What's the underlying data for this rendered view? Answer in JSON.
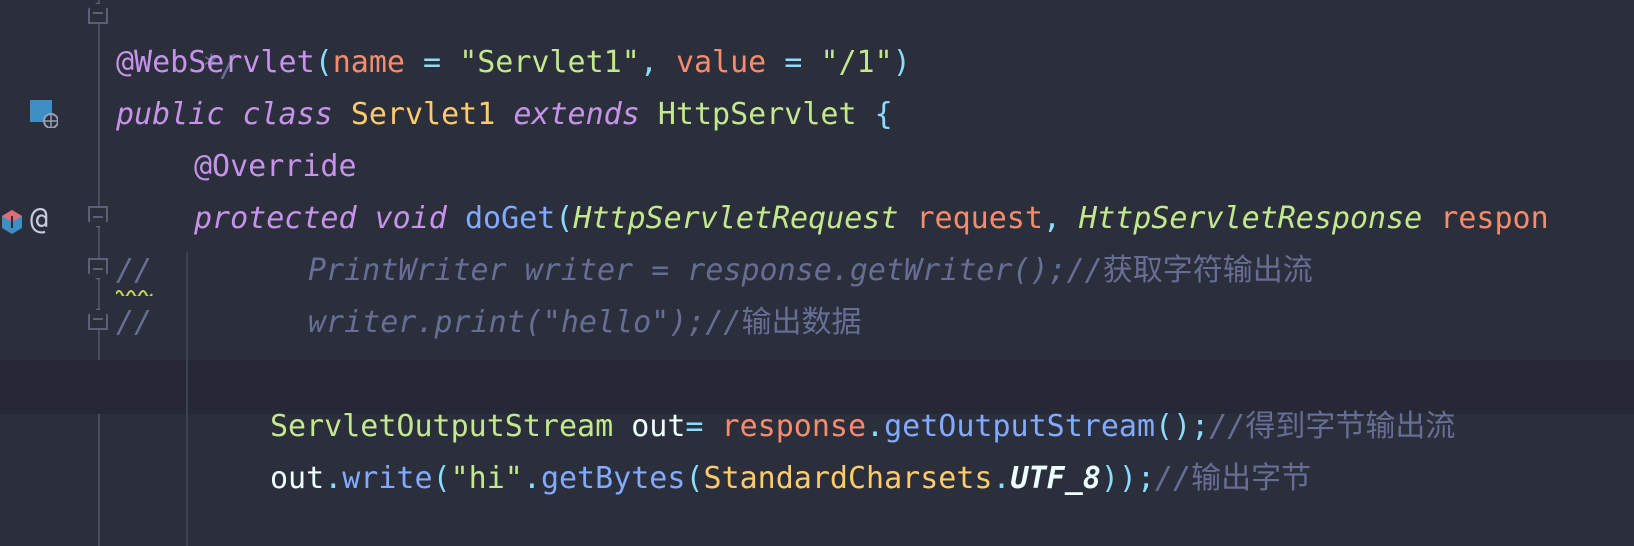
{
  "editor": {
    "lines": {
      "l0": {
        "text": "*/"
      },
      "l1": {
        "annotation": "@WebServlet",
        "open_paren": "(",
        "name_key": "name",
        "eq1": " = ",
        "name_val": "\"Servlet1\"",
        "comma": ", ",
        "value_key": "value",
        "eq2": " = ",
        "value_val": "\"/1\"",
        "close_paren": ")"
      },
      "l2": {
        "kw_public": "public",
        "kw_class": "class",
        "class_name": "Servlet1",
        "kw_extends": "extends",
        "super_name": "HttpServlet",
        "brace": "{"
      },
      "l3": {
        "annotation": "@Override"
      },
      "l4": {
        "kw_protected": "protected",
        "kw_void": "void",
        "method": "doGet",
        "open_paren": "(",
        "type1": "HttpServletRequest",
        "param1": "request",
        "comma": ", ",
        "type2": "HttpServletResponse",
        "param2": "respon"
      },
      "l5": {
        "slashes": "//",
        "code": "PrintWriter writer = response.getWriter();//",
        "cn": "获取字符输出流"
      },
      "l6": {
        "slashes": "//",
        "code": "writer.print(\"hello\");//",
        "cn": "输出数据"
      },
      "l8": {
        "type": "ServletOutputStream",
        "var": "out",
        "eq": "= ",
        "obj": "response",
        "dot": ".",
        "method": "getOutputStream",
        "call": "();",
        "comment": "//",
        "cn": "得到字节输出流"
      },
      "l9": {
        "obj": "out",
        "dot1": ".",
        "method1": "write",
        "open1": "(",
        "str": "\"hi\"",
        "dot2": ".",
        "method2": "getBytes",
        "open2": "(",
        "cls": "StandardCharsets",
        "dot3": ".",
        "const": "UTF_8",
        "close": "));",
        "comment": "//",
        "cn": "输出字节"
      }
    },
    "gutter": {
      "at_icon": "@",
      "icons": [
        "servlet-icon",
        "implements-icon",
        "fold-icon"
      ]
    },
    "colors": {
      "background": "#2b2e3b",
      "keyword": "#c792ea",
      "string": "#c3e88d",
      "param": "#f78c6c",
      "function": "#82aaff",
      "class": "#ffcb6b",
      "comment": "#676e95"
    }
  }
}
